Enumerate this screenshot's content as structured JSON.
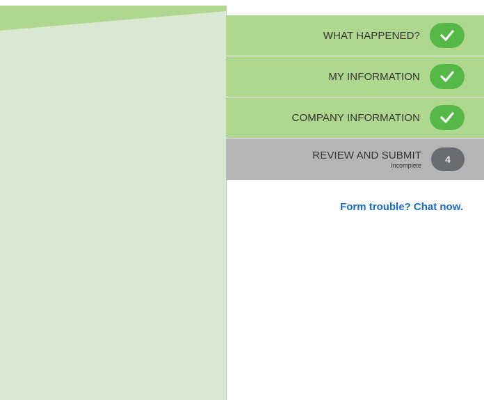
{
  "steps": [
    {
      "label": "WHAT HAPPENED?",
      "status": "complete",
      "icon": "check-icon"
    },
    {
      "label": "MY INFORMATION",
      "status": "complete",
      "icon": "check-icon"
    },
    {
      "label": "COMPANY INFORMATION",
      "status": "complete",
      "icon": "check-icon"
    },
    {
      "label": "REVIEW AND SUBMIT",
      "status": "current",
      "sublabel": "Incomplete",
      "number": "4"
    }
  ],
  "chat_link": "Form trouble? Chat now.",
  "colors": {
    "left_panel": "#d9e9d1",
    "left_panel_accent": "#b0d78f",
    "step_complete": "#b0d78f",
    "step_current": "#b5b5b5",
    "check_badge": "#56b947",
    "number_badge": "#696c70",
    "link": "#1a6bb8"
  }
}
